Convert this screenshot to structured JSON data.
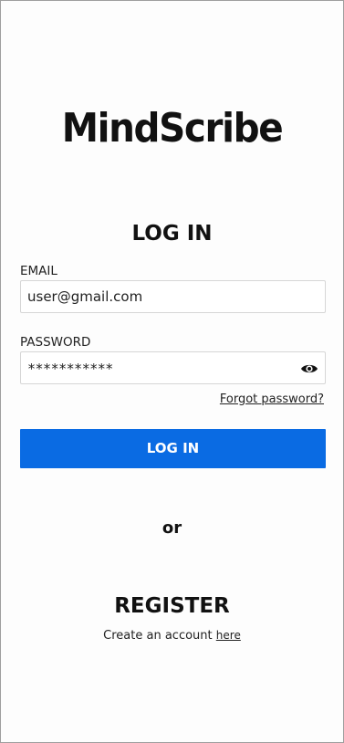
{
  "app": {
    "logo_text": "MindScribe"
  },
  "login": {
    "title": "LOG IN",
    "email_label": "EMAIL",
    "email_value": "user@gmail.com",
    "password_label": "PASSWORD",
    "password_masked": "***********",
    "password_toggle_icon": "eye-icon",
    "forgot_password": "Forgot password?",
    "button_label": "LOG IN",
    "button_color": "#0a6be3"
  },
  "separator": {
    "text": "or"
  },
  "register": {
    "title": "REGISTER",
    "prompt": "Create an account",
    "link_text": "here"
  }
}
